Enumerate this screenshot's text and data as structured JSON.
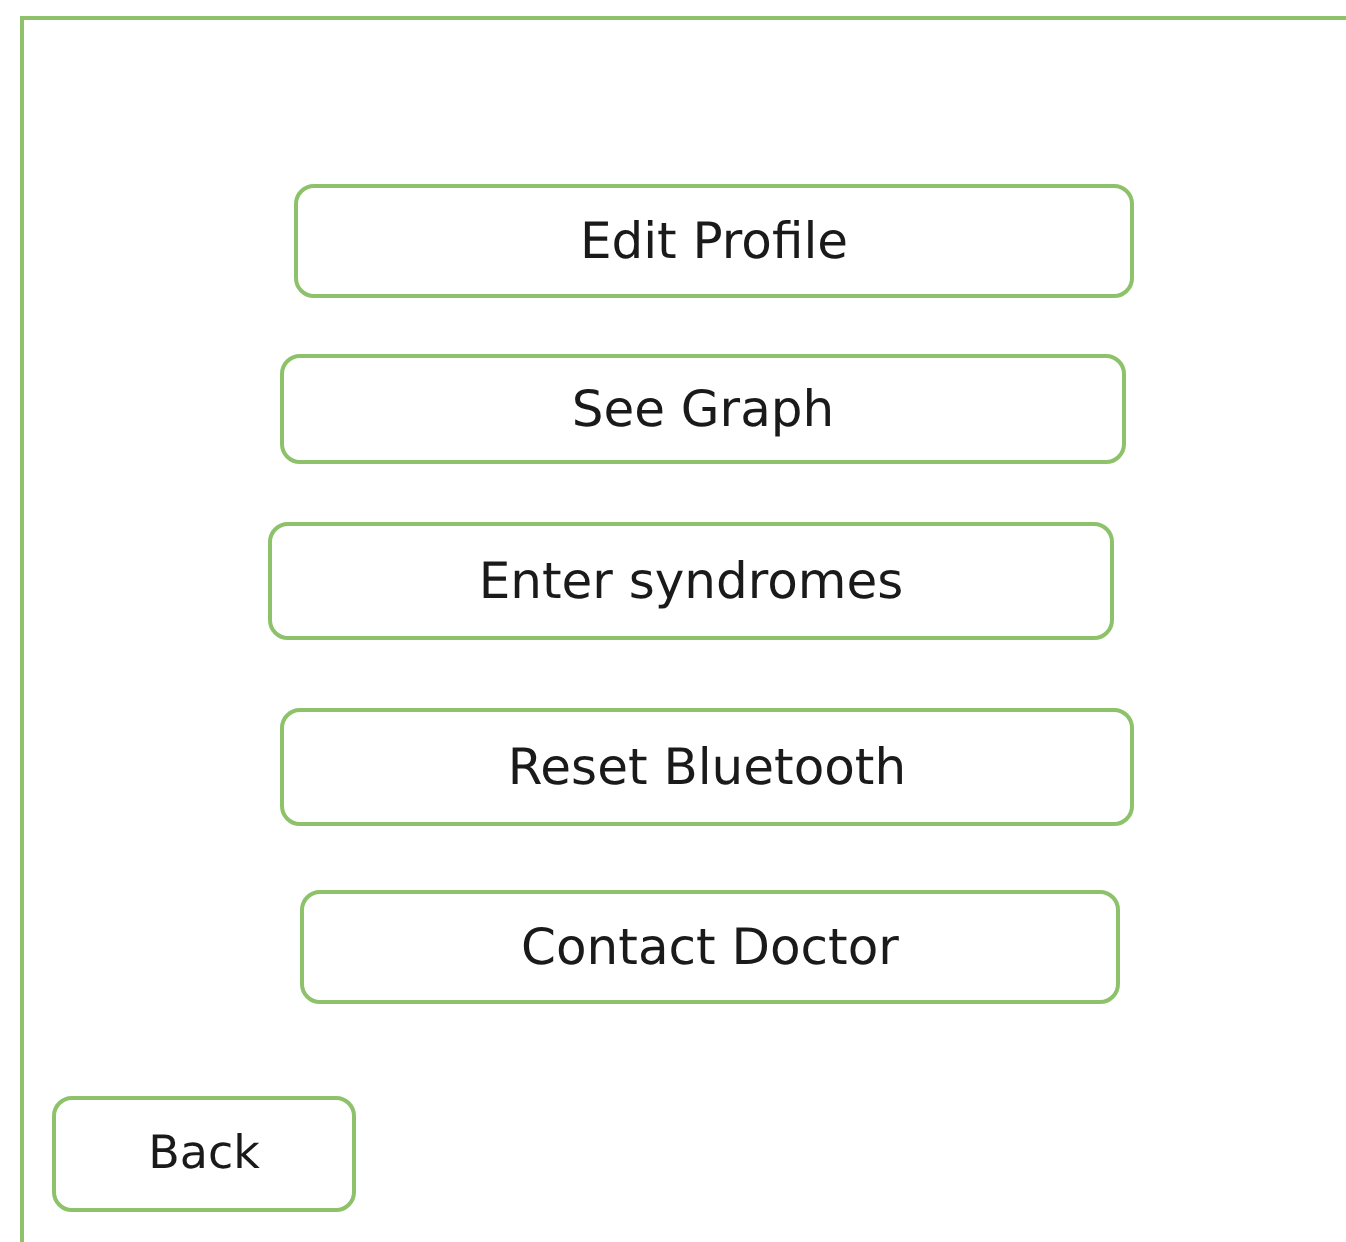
{
  "menu_buttons": [
    {
      "label": "Edit Profile"
    },
    {
      "label": "See Graph"
    },
    {
      "label": "Enter syndromes"
    },
    {
      "label": "Reset Bluetooth"
    },
    {
      "label": "Contact Doctor"
    }
  ],
  "back_button": {
    "label": "Back"
  }
}
